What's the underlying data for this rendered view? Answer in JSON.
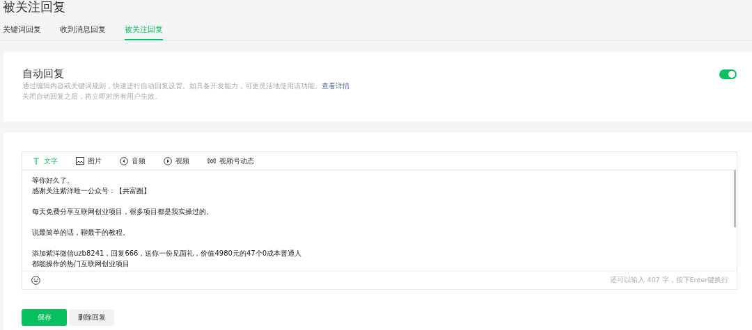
{
  "page_title": "被关注回复",
  "tabs": [
    {
      "label": "关键词回复",
      "selected": false
    },
    {
      "label": "收到消息回复",
      "selected": false
    },
    {
      "label": "被关注回复",
      "selected": true
    }
  ],
  "auto_reply": {
    "title": "自动回复",
    "description": "通过编辑内容或关键词规则，快速进行自动回复设置。如具备开发能力，可更灵活地使用该功能。",
    "details_link": "查看详情",
    "note": "关闭自动回复之后，将立即对所有用户生效。",
    "on": true
  },
  "editor": {
    "types": [
      {
        "kind": "text",
        "label": "文字",
        "selected": true
      },
      {
        "kind": "image",
        "label": "图片",
        "selected": false
      },
      {
        "kind": "audio",
        "label": "音频",
        "selected": false
      },
      {
        "kind": "video",
        "label": "视频",
        "selected": false
      },
      {
        "kind": "channels",
        "label": "视频号动态",
        "selected": false
      }
    ],
    "paragraphs": [
      [
        "等你好久了。",
        "感谢关注紫洋唯一公众号：【共富圈】"
      ],
      [
        "每天免费分享互联网创业项目，很多项目都是我实操过的。"
      ],
      [
        "说最简单的话，聊最干的教程。"
      ],
      [
        "添加紫洋微信uzb8241，回复666，送你一份见面礼，价值4980元的47个0成本普通人",
        "都能操作的热门互联网创业项目"
      ]
    ],
    "counter": "还可以输入 407 字，按下Enter键换行"
  },
  "buttons": [
    {
      "kind": "primary",
      "label": "保存"
    },
    {
      "kind": "secondary",
      "label": "删除回复"
    }
  ]
}
